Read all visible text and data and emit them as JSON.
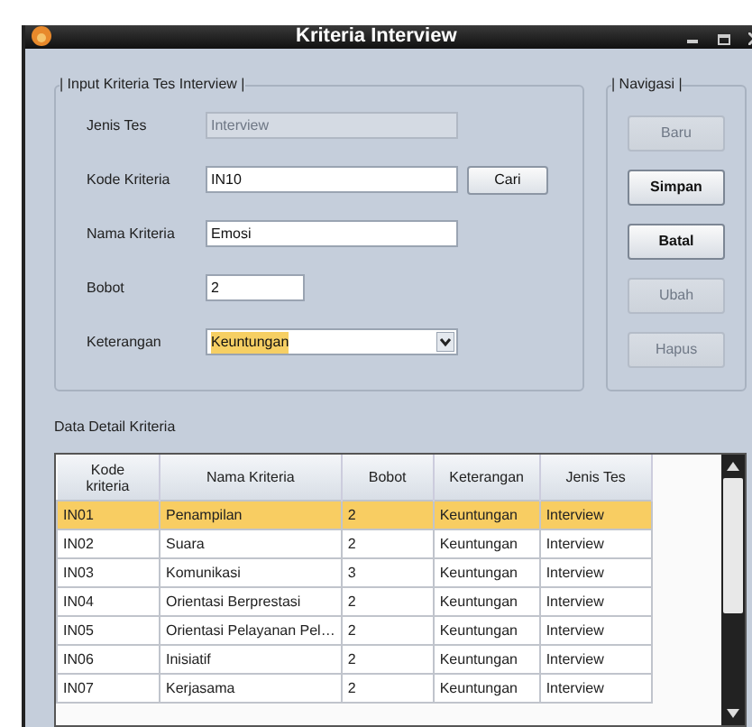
{
  "window": {
    "title": "Kriteria Interview"
  },
  "input_group": {
    "title": "| Input Kriteria Tes Interview |",
    "fields": [
      {
        "label": "Jenis Tes",
        "value": "Interview",
        "disabled": true,
        "kind": "text"
      },
      {
        "label": "Kode Kriteria",
        "value": "IN10",
        "disabled": false,
        "kind": "text",
        "button": "Cari"
      },
      {
        "label": "Nama Kriteria",
        "value": "Emosi",
        "disabled": false,
        "kind": "text"
      },
      {
        "label": "Bobot",
        "value": "2",
        "disabled": false,
        "kind": "short"
      },
      {
        "label": "Keterangan",
        "value": "Keuntungan",
        "disabled": false,
        "kind": "combo",
        "highlighted": true
      }
    ]
  },
  "nav_group": {
    "title": "| Navigasi |",
    "buttons": [
      {
        "label": "Baru",
        "disabled": true
      },
      {
        "label": "Simpan",
        "disabled": false
      },
      {
        "label": "Batal",
        "disabled": false
      },
      {
        "label": "Ubah",
        "disabled": true
      },
      {
        "label": "Hapus",
        "disabled": true
      }
    ]
  },
  "table_title": "Data Detail Kriteria",
  "table": {
    "columns": [
      "Kode kriteria",
      "Nama Kriteria",
      "Bobot",
      "Keterangan",
      "Jenis Tes"
    ],
    "rows": [
      {
        "cells": [
          "IN01",
          "Penampilan",
          "2",
          "Keuntungan",
          "Interview"
        ],
        "selected": true
      },
      {
        "cells": [
          "IN02",
          "Suara",
          "2",
          "Keuntungan",
          "Interview"
        ],
        "selected": false
      },
      {
        "cells": [
          "IN03",
          "Komunikasi",
          "3",
          "Keuntungan",
          "Interview"
        ],
        "selected": false
      },
      {
        "cells": [
          "IN04",
          "Orientasi Berprestasi",
          "2",
          "Keuntungan",
          "Interview"
        ],
        "selected": false
      },
      {
        "cells": [
          "IN05",
          "Orientasi Pelayanan Pel…",
          "2",
          "Keuntungan",
          "Interview"
        ],
        "selected": false
      },
      {
        "cells": [
          "IN06",
          "Inisiatif",
          "2",
          "Keuntungan",
          "Interview"
        ],
        "selected": false
      },
      {
        "cells": [
          "IN07",
          "Kerjasama",
          "2",
          "Keuntungan",
          "Interview"
        ],
        "selected": false
      }
    ]
  }
}
